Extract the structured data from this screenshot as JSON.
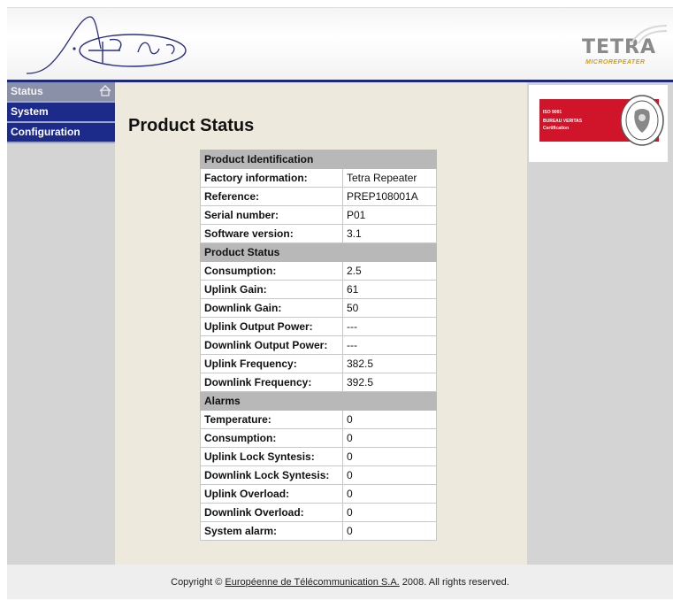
{
  "header": {
    "brand_logo_icon": "signal-wave-logo",
    "tetra_logo_text": "TETRA",
    "tetra_logo_subtext": "MICROREPEATER"
  },
  "nav": {
    "items": [
      {
        "label": "Status",
        "active": true
      },
      {
        "label": "System",
        "active": false
      },
      {
        "label": "Configuration",
        "active": false
      }
    ],
    "home_icon": "home-icon"
  },
  "main": {
    "title": "Product Status",
    "sections": [
      {
        "heading": "Product Identification",
        "rows": [
          {
            "label": "Factory information:",
            "value": "Tetra Repeater"
          },
          {
            "label": "Reference:",
            "value": "PREP108001A"
          },
          {
            "label": "Serial number:",
            "value": "P01"
          },
          {
            "label": "Software version:",
            "value": "3.1"
          }
        ]
      },
      {
        "heading": "Product Status",
        "rows": [
          {
            "label": "Consumption:",
            "value": "2.5"
          },
          {
            "label": "Uplink Gain:",
            "value": "61"
          },
          {
            "label": "Downlink Gain:",
            "value": "50"
          },
          {
            "label": "Uplink Output Power:",
            "value": "---"
          },
          {
            "label": "Downlink Output Power:",
            "value": "---"
          },
          {
            "label": "Uplink Frequency:",
            "value": "382.5"
          },
          {
            "label": "Downlink Frequency:",
            "value": "392.5"
          }
        ]
      },
      {
        "heading": "Alarms",
        "rows": [
          {
            "label": "Temperature:",
            "value": "0"
          },
          {
            "label": "Consumption:",
            "value": "0"
          },
          {
            "label": "Uplink Lock Syntesis:",
            "value": "0"
          },
          {
            "label": "Downlink Lock Syntesis:",
            "value": "0"
          },
          {
            "label": "Uplink Overload:",
            "value": "0"
          },
          {
            "label": "Downlink Overload:",
            "value": "0"
          },
          {
            "label": "System alarm:",
            "value": "0"
          }
        ]
      }
    ]
  },
  "certification": {
    "line1": "ISO 9001",
    "line2": "BUREAU VERITAS",
    "line3": "Certification",
    "seal_icon": "bureau-veritas-seal"
  },
  "footer": {
    "prefix": "Copyright © ",
    "link_text": "Européenne de Télécommunication S.A.",
    "suffix": " 2008. All rights reserved."
  },
  "colors": {
    "nav_blue": "#1c2a8a",
    "header_rule": "#1c2a78",
    "content_bg": "#ede9dd",
    "section_header": "#b8b8b8",
    "cert_red": "#d0142a"
  }
}
